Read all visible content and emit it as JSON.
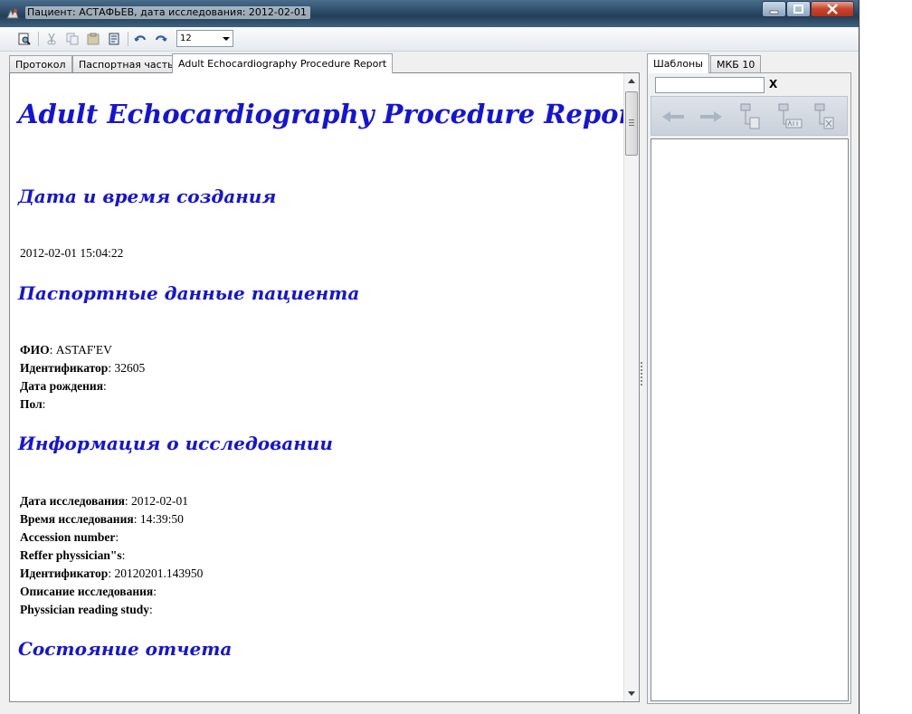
{
  "window": {
    "title": "Пациент: АСТАФЬЕВ, дата исследования: 2012-02-01"
  },
  "toolbar": {
    "buttons": [
      "print-preview",
      "cut",
      "copy",
      "paste",
      "find",
      "undo",
      "redo"
    ],
    "font_size": "12"
  },
  "tabs": {
    "items": [
      {
        "label": "Протокол"
      },
      {
        "label": "Паспортная часть"
      },
      {
        "label": "Adult Echocardiography Procedure Report"
      }
    ],
    "active": 2
  },
  "report": {
    "title": "Adult Echocardiography Procedure Report",
    "sec_created": "Дата и время создания",
    "created_value": "2012-02-01 15:04:22",
    "sec_passport": "Паспортные данные пациента",
    "fio_label": "ФИО",
    "fio_value": "ASTAF'EV",
    "id_label": "Идентификатор",
    "id_value": "32605",
    "birth_label": "Дата рождения",
    "birth_value": "",
    "sex_label": "Пол",
    "sex_value": "",
    "sec_study": "Информация о исследовании",
    "study_date_label": "Дата исследования",
    "study_date_value": "2012-02-01",
    "study_time_label": "Время исследования",
    "study_time_value": "14:39:50",
    "accession_label": "Accession number",
    "accession_value": "",
    "reffer_label": "Reffer physsician\"s",
    "reffer_value": "",
    "study_id_label": "Идентификатор",
    "study_id_value": "20120201.143950",
    "study_desc_label": "Описание исследования",
    "study_desc_value": "",
    "reading_label": "Physsician reading study",
    "reading_value": "",
    "sec_status": "Состояние отчета"
  },
  "side": {
    "tabs": [
      {
        "label": "Шаблоны"
      },
      {
        "label": "МКБ 10"
      }
    ],
    "active": 0,
    "search_value": "",
    "clear_label": "X",
    "tool_buttons": [
      "back-arrow",
      "forward-arrow",
      "add-template",
      "rename-template",
      "delete-template"
    ]
  },
  "colors": {
    "heading": "#1414d6",
    "title_bar": "#2e4e6b"
  }
}
